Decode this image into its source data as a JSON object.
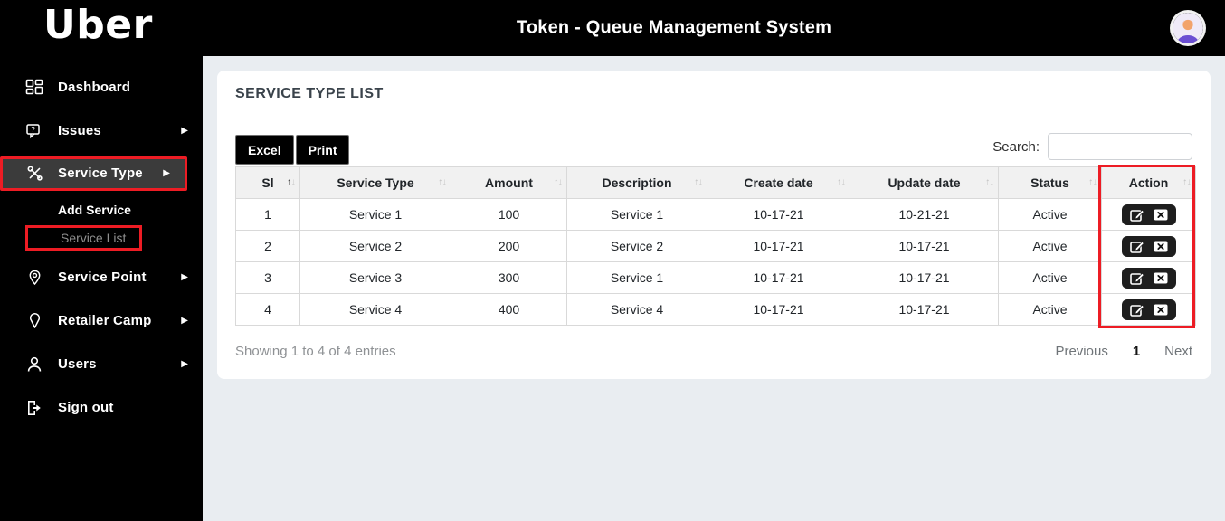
{
  "header": {
    "logo_text": "Uber",
    "title": "Token - Queue Management System"
  },
  "sidebar": {
    "dashboard": "Dashboard",
    "issues": "Issues",
    "service_type": "Service Type",
    "add_service": "Add Service",
    "service_list": "Service List",
    "service_point": "Service Point",
    "retailer_camp": "Retailer Camp",
    "users": "Users",
    "sign_out": "Sign out"
  },
  "card": {
    "title": "SERVICE TYPE LIST"
  },
  "toolbar": {
    "excel": "Excel",
    "print": "Print",
    "search_label": "Search:",
    "search_value": ""
  },
  "table": {
    "columns": [
      "Sl",
      "Service Type",
      "Amount",
      "Description",
      "Create date",
      "Update date",
      "Status",
      "Action"
    ],
    "rows": [
      {
        "sl": "1",
        "service_type": "Service 1",
        "amount": "100",
        "description": "Service 1",
        "create_date": "10-17-21",
        "update_date": "10-21-21",
        "status": "Active"
      },
      {
        "sl": "2",
        "service_type": "Service 2",
        "amount": "200",
        "description": "Service 2",
        "create_date": "10-17-21",
        "update_date": "10-17-21",
        "status": "Active"
      },
      {
        "sl": "3",
        "service_type": "Service 3",
        "amount": "300",
        "description": "Service 1",
        "create_date": "10-17-21",
        "update_date": "10-17-21",
        "status": "Active"
      },
      {
        "sl": "4",
        "service_type": "Service 4",
        "amount": "400",
        "description": "Service 4",
        "create_date": "10-17-21",
        "update_date": "10-17-21",
        "status": "Active"
      }
    ]
  },
  "footer": {
    "showing": "Showing 1 to 4 of 4 entries",
    "previous": "Previous",
    "current_page": "1",
    "next": "Next"
  },
  "icons": {
    "caret_right": "▶",
    "sort_up": "↑",
    "sort_down": "↓"
  },
  "colors": {
    "highlight_red": "#ed1c24",
    "sidebar_bg": "#000000",
    "header_bg": "#000000",
    "page_bg": "#e9edf1",
    "table_header_bg": "#f1f1f1",
    "action_button_bg": "#1e1e1e"
  }
}
